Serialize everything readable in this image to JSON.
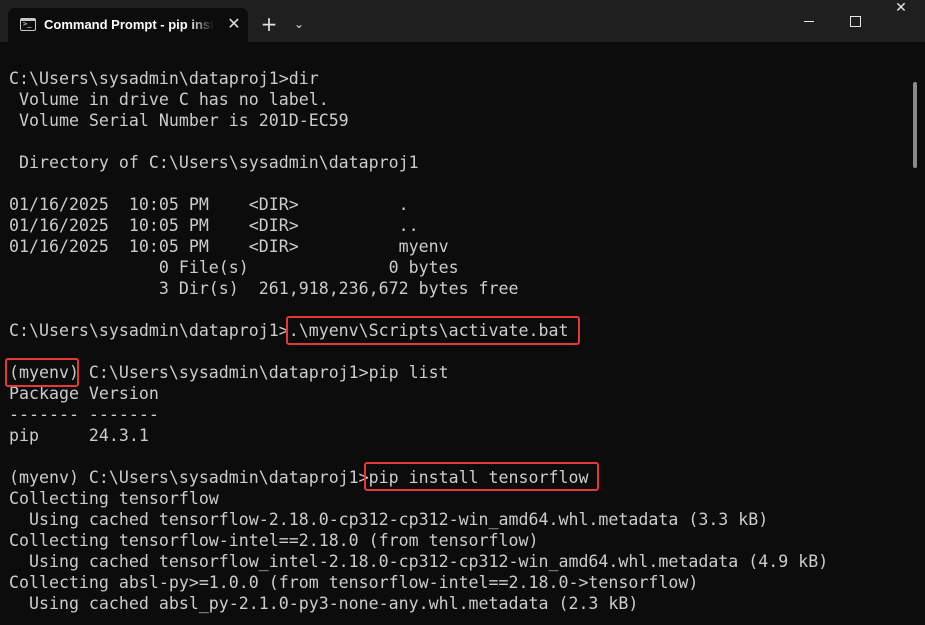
{
  "window": {
    "tab_title": "Command Prompt - pip  install tensorflow",
    "tab_icon_glyph": ">_",
    "new_tab_glyph": "+",
    "dropdown_glyph": "⌄",
    "close_tab_glyph": "✕",
    "close_window_glyph": "✕"
  },
  "terminal": {
    "lines": [
      "",
      "C:\\Users\\sysadmin\\dataproj1>dir",
      " Volume in drive C has no label.",
      " Volume Serial Number is 201D-EC59",
      "",
      " Directory of C:\\Users\\sysadmin\\dataproj1",
      "",
      "01/16/2025  10:05 PM    <DIR>          .",
      "01/16/2025  10:05 PM    <DIR>          ..",
      "01/16/2025  10:05 PM    <DIR>          myenv",
      "               0 File(s)              0 bytes",
      "               3 Dir(s)  261,918,236,672 bytes free",
      "",
      "C:\\Users\\sysadmin\\dataproj1>.\\myenv\\Scripts\\activate.bat",
      "",
      "(myenv) C:\\Users\\sysadmin\\dataproj1>pip list",
      "Package Version",
      "------- -------",
      "pip     24.3.1",
      "",
      "(myenv) C:\\Users\\sysadmin\\dataproj1>pip install tensorflow",
      "Collecting tensorflow",
      "  Using cached tensorflow-2.18.0-cp312-cp312-win_amd64.whl.metadata (3.3 kB)",
      "Collecting tensorflow-intel==2.18.0 (from tensorflow)",
      "  Using cached tensorflow_intel-2.18.0-cp312-cp312-win_amd64.whl.metadata (4.9 kB)",
      "Collecting absl-py>=1.0.0 (from tensorflow-intel==2.18.0->tensorflow)",
      "  Using cached absl_py-2.1.0-py3-none-any.whl.metadata (2.3 kB)"
    ]
  },
  "highlight_color": "#e53935"
}
